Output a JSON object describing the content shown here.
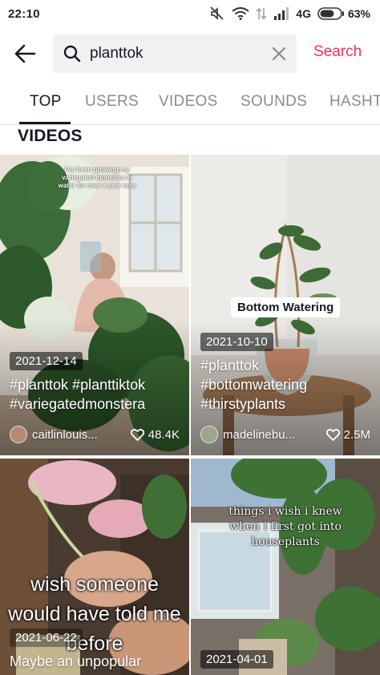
{
  "status_bar": {
    "time": "22:10",
    "network": "4G",
    "battery": "63%"
  },
  "search": {
    "query": "planttok",
    "button_label": "Search"
  },
  "tabs": [
    {
      "label": "TOP",
      "active": true
    },
    {
      "label": "USERS",
      "active": false
    },
    {
      "label": "VIDEOS",
      "active": false
    },
    {
      "label": "SOUNDS",
      "active": false
    },
    {
      "label": "HASHTAGS",
      "active": false
    }
  ],
  "section_title": "VIDEOS",
  "videos": [
    {
      "date": "2021-12-14",
      "overlay_text": "I've been growing my variegated monstera in water for over a year now",
      "caption_lines": [
        "#planttok #planttiktok",
        "#variegatedmonstera"
      ],
      "username": "caitlinlouis...",
      "likes": "48.4K"
    },
    {
      "date": "2021-10-10",
      "overlay_text": "Bottom Watering",
      "caption_lines": [
        "#planttok",
        "#bottomwatering",
        "#thirstyplants"
      ],
      "username": "madelinebu...",
      "likes": "2.5M"
    },
    {
      "date": "2021-06-22",
      "overlay_text": "wish someone would have told me before",
      "caption_lines": [
        "Maybe an unpopular"
      ]
    },
    {
      "date": "2021-04-01",
      "overlay_text": "things i wish i knew when i first got into houseplants"
    }
  ],
  "colors": {
    "accent": "#fe2c55",
    "text": "#161823",
    "muted": "#8a8b91",
    "search_bg": "#f1f1f2"
  }
}
